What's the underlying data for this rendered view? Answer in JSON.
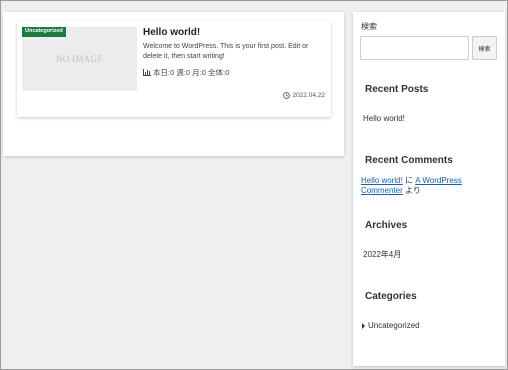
{
  "post": {
    "category": "Uncategorized",
    "thumbnail_text": "NO IMAGE",
    "title": "Hello world!",
    "excerpt": "Welcome to WordPress. This is your first post. Edit or delete it, then start writing!",
    "stats_icon": "bar-chart-icon",
    "stats": "本日:0 週:0 月:0 全体:0",
    "date_icon": "clock-icon",
    "date": "2022.04.22",
    "badge_color": "#1e7a45"
  },
  "sidebar": {
    "search": {
      "label": "検索",
      "value": "",
      "button_label": "検索"
    },
    "recent_posts": {
      "title": "Recent Posts",
      "items": [
        "Hello world!"
      ]
    },
    "recent_comments": {
      "title": "Recent Comments",
      "post_link": "Hello world!",
      "connector": " に ",
      "author_link": "A WordPress Commenter",
      "suffix": " より"
    },
    "archives": {
      "title": "Archives",
      "items": [
        "2022年4月"
      ]
    },
    "categories": {
      "title": "Categories",
      "items": [
        "Uncategorized"
      ]
    }
  },
  "colors": {
    "link": "#1a5fb4",
    "background": "#efefef"
  }
}
